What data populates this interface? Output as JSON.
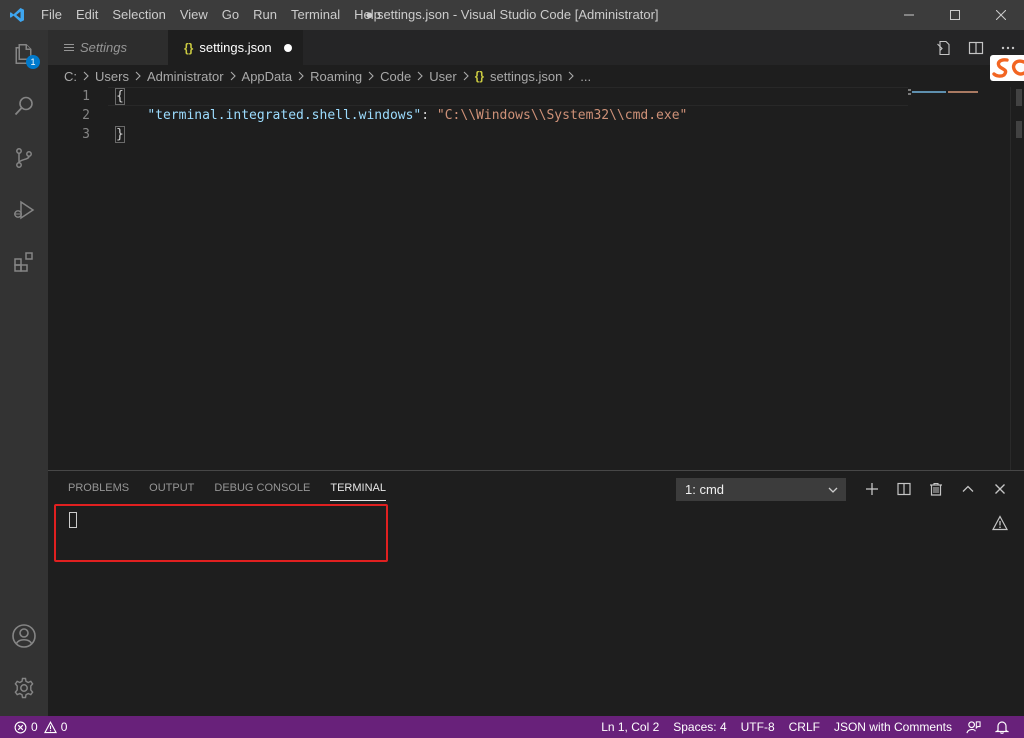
{
  "titlebar": {
    "window_title": "● settings.json - Visual Studio Code [Administrator]",
    "menu": [
      "File",
      "Edit",
      "Selection",
      "View",
      "Go",
      "Run",
      "Terminal",
      "Help"
    ]
  },
  "activitybar": {
    "explorer_badge": "1",
    "items": [
      "explorer",
      "search",
      "source-control",
      "run-debug",
      "extensions",
      "accounts",
      "manage"
    ]
  },
  "tabs": [
    {
      "label": "Settings",
      "icon": "settings-lines-icon",
      "active": false
    },
    {
      "label": "settings.json",
      "icon": "json-braces-icon",
      "active": true,
      "dirty": true
    }
  ],
  "breadcrumbs": [
    "C:",
    "Users",
    "Administrator",
    "AppData",
    "Roaming",
    "Code",
    "User",
    "settings.json",
    "..."
  ],
  "editor": {
    "language": "JSON with Comments",
    "line_numbers": [
      "1",
      "2",
      "3"
    ],
    "line1": "{",
    "line2_key": "\"terminal.integrated.shell.windows\"",
    "line2_colon": ": ",
    "line2_value": "\"C:\\\\Windows\\\\System32\\\\cmd.exe\"",
    "line3": "}"
  },
  "panel": {
    "tabs": [
      "PROBLEMS",
      "OUTPUT",
      "DEBUG CONSOLE",
      "TERMINAL"
    ],
    "active_tab": "TERMINAL",
    "terminal_select": "1: cmd"
  },
  "statusbar": {
    "errors": "0",
    "warnings": "0",
    "cursor_position": "Ln 1, Col 2",
    "indentation": "Spaces: 4",
    "encoding": "UTF-8",
    "eol": "CRLF",
    "language_mode": "JSON with Comments"
  },
  "colors": {
    "statusbar_bg": "#68217a",
    "activitybar_bg": "#333333",
    "editor_bg": "#1e1e1e",
    "highlight_border": "#e02020",
    "badge_bg": "#007acc"
  }
}
